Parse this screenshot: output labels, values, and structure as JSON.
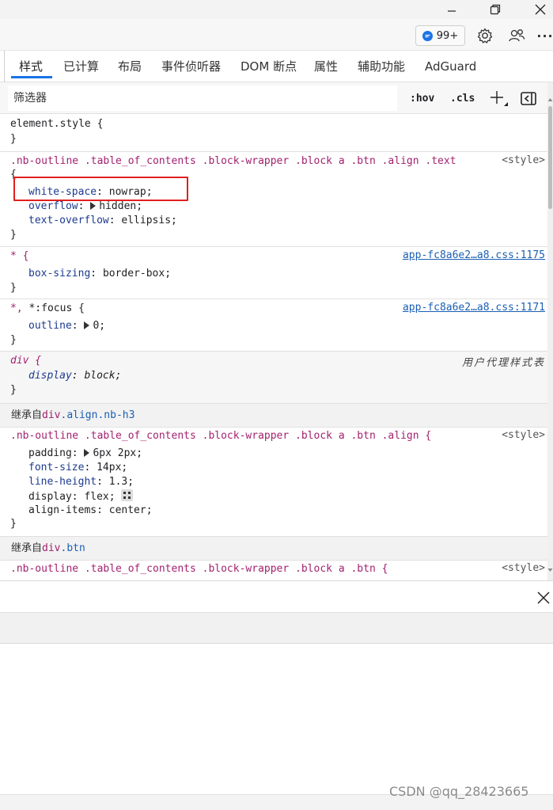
{
  "window": {
    "minimize_label": "minimize",
    "restore_label": "restore",
    "close_label": "close"
  },
  "toolbar": {
    "issues_count": "99+",
    "more_label": "···"
  },
  "tabs": [
    {
      "label": "样式",
      "active": true
    },
    {
      "label": "已计算"
    },
    {
      "label": "布局"
    },
    {
      "label": "事件侦听器"
    },
    {
      "label": "DOM 断点"
    },
    {
      "label": "属性"
    },
    {
      "label": "辅助功能"
    },
    {
      "label": "AdGuard"
    }
  ],
  "filter": {
    "placeholder": "筛选器",
    "hov": ":hov",
    "cls": ".cls"
  },
  "rules": {
    "element_style": {
      "selector": "element.style {",
      "close": "}"
    },
    "text_rule": {
      "selector": ".nb-outline .table_of_contents .block-wrapper .block a .btn .align .text",
      "source": "<style>",
      "open": "{",
      "decls": [
        {
          "prop": "white-space",
          "value": "nowrap;"
        },
        {
          "prop": "overflow",
          "value": "hidden;"
        },
        {
          "prop": "text-overflow",
          "value": "ellipsis;"
        }
      ],
      "close": "}"
    },
    "universal": {
      "selector": "* {",
      "source": "app-fc8a6e2…a8.css:1175",
      "decls": [
        {
          "prop": "box-sizing",
          "value": "border-box;"
        }
      ],
      "close": "}"
    },
    "focus": {
      "selector_star": "*,",
      "selector_focus": "*:focus {",
      "source": "app-fc8a6e2…a8.css:1171",
      "decls": [
        {
          "prop": "outline",
          "value": "0;"
        }
      ],
      "close": "}"
    },
    "div_ua": {
      "selector": "div {",
      "source": "用户代理样式表",
      "decls": [
        {
          "prop": "display",
          "value": "block;"
        }
      ],
      "close": "}"
    },
    "inherit1": {
      "prefix": "继承自",
      "tag": "div",
      "classes": ".align.nb-h3"
    },
    "align_rule": {
      "selector": ".nb-outline .table_of_contents .block-wrapper .block a .btn .align {",
      "source": "<style>",
      "decls": [
        {
          "prop": "padding",
          "value": "6px 2px;"
        },
        {
          "prop": "font-size",
          "value": "14px;"
        },
        {
          "prop": "line-height",
          "value": "1.3;"
        },
        {
          "prop": "display",
          "value": "flex;"
        },
        {
          "prop": "align-items",
          "value": "center;"
        }
      ],
      "close": "}"
    },
    "inherit2": {
      "prefix": "继承自",
      "tag": "div",
      "classes": ".btn"
    },
    "btn_rule": {
      "selector": ".nb-outline .table_of_contents .block-wrapper .block a .btn {",
      "source": "<style>"
    }
  },
  "watermark": "CSDN @qq_28423665"
}
